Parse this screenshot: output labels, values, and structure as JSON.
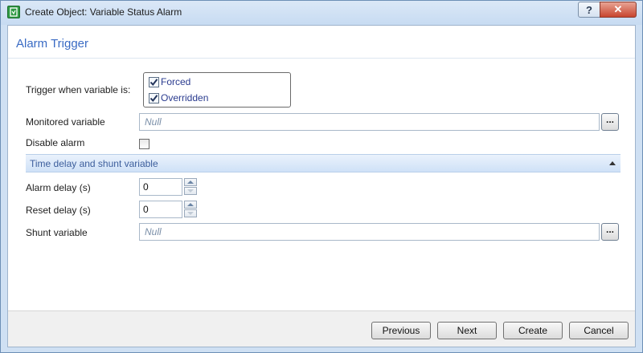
{
  "window": {
    "title": "Create Object: Variable Status Alarm"
  },
  "titlebar": {
    "help_label": "?",
    "close_label": "✕"
  },
  "form": {
    "heading": "Alarm Trigger",
    "trigger_label": "Trigger when variable is:",
    "forced_label": "Forced",
    "forced_checked": true,
    "overridden_label": "Overridden",
    "overridden_checked": true,
    "monitored_label": "Monitored variable",
    "monitored_value": "Null",
    "browse_label": "...",
    "disable_label": "Disable alarm",
    "disable_checked": false
  },
  "section": {
    "title": "Time delay and shunt variable",
    "alarm_delay_label": "Alarm delay (s)",
    "alarm_delay_value": "0",
    "reset_delay_label": "Reset delay (s)",
    "reset_delay_value": "0",
    "shunt_label": "Shunt variable",
    "shunt_value": "Null",
    "browse_label": "..."
  },
  "buttons": {
    "previous": "Previous",
    "next": "Next",
    "create": "Create",
    "cancel": "Cancel"
  }
}
